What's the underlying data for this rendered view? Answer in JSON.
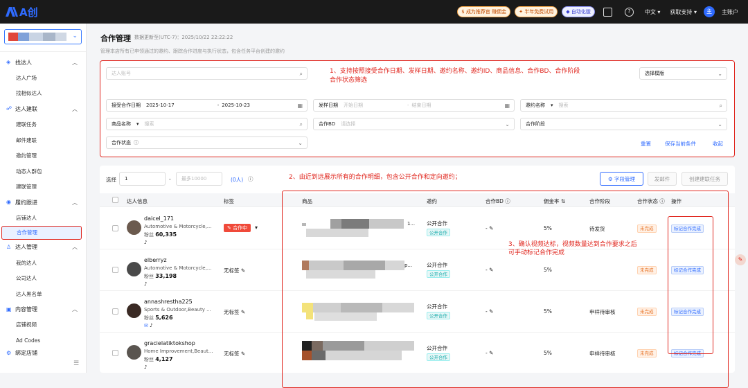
{
  "topbar": {
    "brand": "A创",
    "promo1": "成为推荐官 赚佣金",
    "promo2": "半年免费试用",
    "promo3": "自动化版",
    "lang": "中文",
    "support": "获取支持",
    "account": "主账户",
    "avatar_letter": "主"
  },
  "sidebar": {
    "groups": [
      {
        "label": "找达人",
        "items": [
          "达人广场",
          "找相似达人"
        ]
      },
      {
        "label": "达人建联",
        "items": [
          "建联任务",
          "邮件建联",
          "邀约管理",
          "动态人群包",
          "建联管理"
        ]
      },
      {
        "label": "履约跟进",
        "items": [
          "店铺达人",
          "合作管理"
        ]
      },
      {
        "label": "达人管理",
        "items": [
          "我的达人",
          "公司达人",
          "达人黑名单"
        ]
      },
      {
        "label": "内容管理",
        "items": [
          "店铺视频",
          "Ad Codes"
        ]
      },
      {
        "label": "绑定店铺",
        "items": []
      }
    ],
    "colors": [
      "#e0463a",
      "#7fa1d9",
      "#c9d4e4",
      "#a9b6c9",
      "#d0d8e4",
      "#8ea5c8"
    ]
  },
  "page": {
    "title": "合作管理",
    "updated": "数据更新至(UTC-7)：2025/10/22 22:22:22",
    "desc": "管理本店所有已申领通过的邀约、跟踪合作进度与执行状态，包含任务平台创建的邀约"
  },
  "filter": {
    "search_placeholder": "达人账号",
    "template_select": "选择模版",
    "accept_date_label": "接受合作日期",
    "accept_date_start": "2025-10-17",
    "accept_date_sep": "-",
    "accept_date_end": "2025-10-23",
    "ship_date_label": "发样日期",
    "ship_start_ph": "开始日期",
    "ship_sep": "-",
    "ship_end_ph": "结束日期",
    "invite_name_label": "邀约名称",
    "invite_search_ph": "搜索",
    "product_name_label": "商品名称",
    "product_search_ph": "搜索",
    "bd_label": "合作BD",
    "bd_ph": "请选择",
    "stage_label": "合作阶段",
    "status_label": "合作状态",
    "reset": "重置",
    "save": "保存当前条件",
    "collapse": "收起"
  },
  "annotations": {
    "a1_line1": "1、支持按照接受合作日期、发样日期、邀约名称、邀约ID、商品信息、合作BD、合作阶段",
    "a1_line2": "合作状态筛选",
    "a2": "2、由近到远展示所有的合作明细，包含公开合作和定向邀约；",
    "a3_line1": "3、确认视频达标，视频数量达到合作要求之后",
    "a3_line2": "可手动标记合作完成"
  },
  "toolbar": {
    "select_label": "选择",
    "select_value": "1",
    "range_sep": "-",
    "max_ph": "最多10000",
    "count": "(0人)",
    "field_btn": "字段管理",
    "send_mail": "发邮件",
    "create_task": "创建建联任务"
  },
  "columns": {
    "creator": "达人信息",
    "tag": "标签",
    "product": "商品",
    "invite": "邀约",
    "bd": "合作BD",
    "rate": "佣金率",
    "stage": "合作阶段",
    "status": "合作状态",
    "ops": "操作"
  },
  "rows": [
    {
      "name": "daicel_171",
      "category": "Automotive & Motorcycle,...",
      "fans_label": "粉丝",
      "fans": "60,335",
      "tag": "合作中",
      "product_suffix": "1...",
      "invite": "公开合作",
      "invite_badge": "公开合作",
      "bd": "-",
      "rate": "5%",
      "stage": "待发货",
      "status": "未完成",
      "op": "标记合作完成"
    },
    {
      "name": "elberryz",
      "category": "Automotive & Motorcycle,...",
      "fans_label": "粉丝",
      "fans": "33,198",
      "tag": "无标签",
      "product_suffix": "p...",
      "invite": "公开合作",
      "invite_badge": "公开合作",
      "bd": "-",
      "rate": "5%",
      "stage": "",
      "status": "未完成",
      "op": "标记合作完成"
    },
    {
      "name": "annashrestha225",
      "category": "Sports & Outdoor,Beauty ...",
      "fans_label": "粉丝",
      "fans": "5,626",
      "tag": "无标签",
      "product_suffix": "",
      "invite": "公开合作",
      "invite_badge": "公开合作",
      "bd": "-",
      "rate": "5%",
      "stage": "申样待审核",
      "status": "未完成",
      "op": "标记合作完成"
    },
    {
      "name": "gracielatiktokshop",
      "category": "Home Improvement,Beaut...",
      "fans_label": "粉丝",
      "fans": "4,127",
      "tag": "无标签",
      "product_suffix": "",
      "invite": "公开合作",
      "invite_badge": "公开合作",
      "bd": "-",
      "rate": "5%",
      "stage": "申样待审核",
      "status": "未完成",
      "op": "标记合作完成"
    }
  ],
  "accent_color": "#2f6bff",
  "annotation_color": "#e0261e"
}
